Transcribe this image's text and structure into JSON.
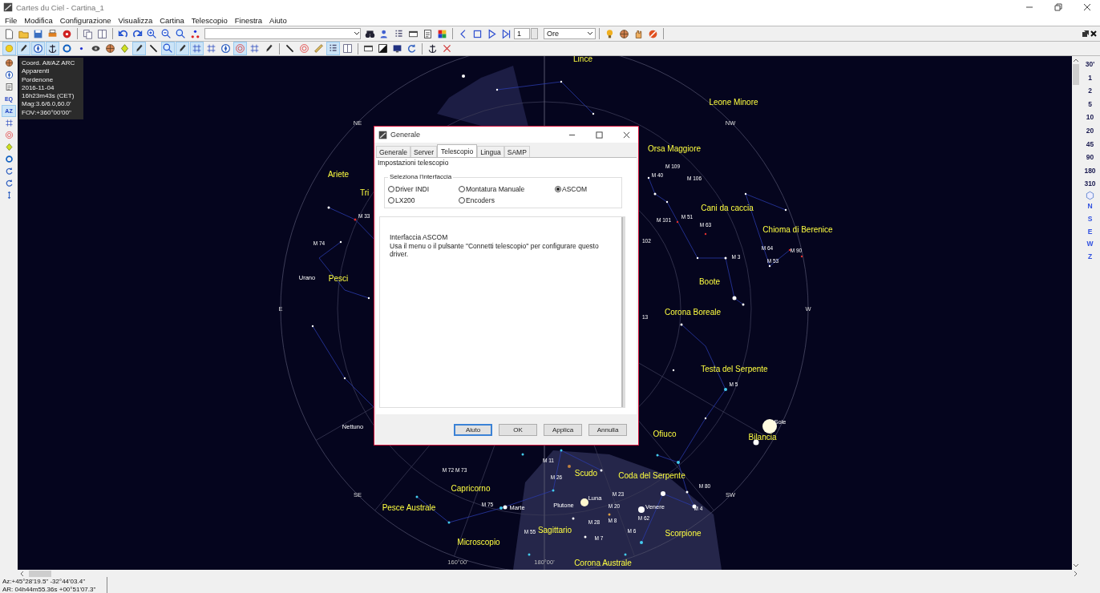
{
  "window": {
    "title": "Cartes du Ciel - Cartina_1"
  },
  "menu": [
    "File",
    "Modifica",
    "Configurazione",
    "Visualizza",
    "Cartina",
    "Telescopio",
    "Finestra",
    "Aiuto"
  ],
  "toolbar_1": {
    "frame_field": {
      "value": "1"
    },
    "step_select": {
      "value": "Ore"
    }
  },
  "toolbar_2": [
    {
      "pressed": true
    },
    {
      "pressed": true
    },
    {
      "pressed": true
    },
    {
      "pressed": true
    },
    {
      "pressed": false
    },
    {
      "pressed": false
    },
    {
      "pressed": false
    },
    {
      "pressed": false
    },
    {
      "pressed": false
    },
    {
      "pressed": true
    },
    {
      "pressed": false
    },
    {
      "pressed": true
    },
    {
      "pressed": true
    },
    {
      "pressed": true
    },
    {
      "pressed": false
    },
    {
      "pressed": false
    },
    {
      "pressed": true
    },
    {
      "pressed": false
    },
    {
      "pressed": false
    },
    {
      "pressed": false
    },
    {
      "pressed": false
    },
    {
      "pressed": false
    },
    {
      "pressed": true
    },
    {
      "pressed": false
    },
    {
      "pressed": false
    },
    {
      "pressed": false
    },
    {
      "pressed": false
    },
    {
      "pressed": false
    },
    {
      "pressed": false
    },
    {
      "pressed": false
    }
  ],
  "left_toolbar": [
    {
      "pressed": false
    },
    {
      "pressed": false
    },
    {
      "pressed": false
    },
    {
      "label": "EQ",
      "pressed": false
    },
    {
      "label": "AZ",
      "pressed": true
    },
    {
      "pressed": false
    },
    {
      "pressed": false
    },
    {
      "pressed": false
    },
    {
      "pressed": false
    },
    {
      "pressed": false
    },
    {
      "pressed": false
    },
    {
      "pressed": false
    }
  ],
  "info_panel": {
    "lines": [
      "Coord. Alt/AZ ARC",
      "Apparenti",
      "Pordenone",
      "2016-11-04",
      "16h23m43s (CET)",
      "Mag:3.6/6.0,60.0'",
      "FOV:+360°00'00\""
    ]
  },
  "sky_map": {
    "labels": [
      {
        "text": "Lince",
        "kind": "constellation"
      },
      {
        "text": "Leone Minore",
        "kind": "constellation"
      },
      {
        "text": "NE",
        "kind": "direction"
      },
      {
        "text": "NW",
        "kind": "direction"
      },
      {
        "text": "Orsa Maggiore",
        "kind": "constellation"
      },
      {
        "text": "M 109",
        "kind": "object"
      },
      {
        "text": "Ariete",
        "kind": "constellation"
      },
      {
        "text": "M 40",
        "kind": "object"
      },
      {
        "text": "M 106",
        "kind": "object"
      },
      {
        "text": "Tri",
        "kind": "constellation"
      },
      {
        "text": "Cani da caccia",
        "kind": "constellation"
      },
      {
        "text": "M 33",
        "kind": "object"
      },
      {
        "text": "M 51",
        "kind": "object"
      },
      {
        "text": "M 101",
        "kind": "object"
      },
      {
        "text": "M 63",
        "kind": "object"
      },
      {
        "text": "Chioma di Berenice",
        "kind": "constellation"
      },
      {
        "text": "102",
        "kind": "object"
      },
      {
        "text": "M 74",
        "kind": "object"
      },
      {
        "text": "M 64",
        "kind": "object"
      },
      {
        "text": "M 90",
        "kind": "object"
      },
      {
        "text": "M 3",
        "kind": "object"
      },
      {
        "text": "M 53",
        "kind": "object"
      },
      {
        "text": "Urano",
        "kind": "planet"
      },
      {
        "text": "Pesci",
        "kind": "constellation"
      },
      {
        "text": "Boote",
        "kind": "constellation"
      },
      {
        "text": "E",
        "kind": "direction"
      },
      {
        "text": "W",
        "kind": "direction"
      },
      {
        "text": "Corona Boreale",
        "kind": "constellation"
      },
      {
        "text": "13",
        "kind": "object"
      },
      {
        "text": "Testa del Serpente",
        "kind": "constellation"
      },
      {
        "text": "M 5",
        "kind": "object"
      },
      {
        "text": "Sole",
        "kind": "planet"
      },
      {
        "text": "Nettuno",
        "kind": "planet"
      },
      {
        "text": "Ofiuco",
        "kind": "constellation"
      },
      {
        "text": "Bilancia",
        "kind": "constellation"
      },
      {
        "text": "M 11",
        "kind": "object"
      },
      {
        "text": "M 72 M 73",
        "kind": "object"
      },
      {
        "text": "M 26",
        "kind": "object"
      },
      {
        "text": "Scudo",
        "kind": "constellation"
      },
      {
        "text": "Coda del Serpente",
        "kind": "constellation"
      },
      {
        "text": "M 80",
        "kind": "object"
      },
      {
        "text": "Capricorno",
        "kind": "constellation"
      },
      {
        "text": "SE",
        "kind": "direction"
      },
      {
        "text": "Luna",
        "kind": "planet"
      },
      {
        "text": "M 23",
        "kind": "object"
      },
      {
        "text": "SW",
        "kind": "direction"
      },
      {
        "text": "Pesce Australe",
        "kind": "constellation"
      },
      {
        "text": "M 75",
        "kind": "object"
      },
      {
        "text": "Marte",
        "kind": "planet"
      },
      {
        "text": "Plutone",
        "kind": "planet"
      },
      {
        "text": "M 20",
        "kind": "object"
      },
      {
        "text": "Venere",
        "kind": "planet"
      },
      {
        "text": "M 4",
        "kind": "object"
      },
      {
        "text": "M 28",
        "kind": "object"
      },
      {
        "text": "M 8",
        "kind": "object"
      },
      {
        "text": "M 62",
        "kind": "object"
      },
      {
        "text": "M 55",
        "kind": "object"
      },
      {
        "text": "Sagittario",
        "kind": "constellation"
      },
      {
        "text": "M 6",
        "kind": "object"
      },
      {
        "text": "Scorpione",
        "kind": "constellation"
      },
      {
        "text": "M 7",
        "kind": "object"
      },
      {
        "text": "Microscopio",
        "kind": "constellation"
      },
      {
        "text": "160°00'",
        "kind": "scale"
      },
      {
        "text": "180°00'",
        "kind": "scale"
      },
      {
        "text": "Corona Australe",
        "kind": "constellation"
      }
    ]
  },
  "zoom_panel": {
    "fields": [
      "30'",
      "1",
      "2",
      "5",
      "10",
      "20",
      "45",
      "90",
      "180",
      "310"
    ],
    "directions": [
      "N",
      "S",
      "E",
      "W",
      "Z"
    ]
  },
  "dialog": {
    "title": "Generale",
    "tabs": [
      {
        "label": "Generale",
        "selected": false
      },
      {
        "label": "Server",
        "selected": false
      },
      {
        "label": "Telescopio",
        "selected": true
      },
      {
        "label": "Lingua",
        "selected": false
      },
      {
        "label": "SAMP",
        "selected": false
      }
    ],
    "heading": "Impostazioni telescopio",
    "group": {
      "title": "Seleziona l'interfaccia",
      "options": [
        {
          "label": "Driver INDI",
          "selected": false
        },
        {
          "label": "Montatura Manuale",
          "selected": false
        },
        {
          "label": "ASCOM",
          "selected": true
        },
        {
          "label": "LX200",
          "selected": false
        },
        {
          "label": "Encoders",
          "selected": false
        }
      ]
    },
    "info_lines": [
      "Interfaccia ASCOM",
      "Usa il menu o il pulsante \"Connetti telescopio\" per configurare questo driver."
    ],
    "buttons": [
      {
        "label": "Aiuto",
        "focused": true
      },
      {
        "label": "OK",
        "focused": false
      },
      {
        "label": "Applica",
        "focused": false
      },
      {
        "label": "Annulla",
        "focused": false
      }
    ]
  },
  "status_bar": {
    "lines": [
      "Az:+45°28'19.5\" -32°44'03.4\"",
      "AR: 04h44m55.36s +00°51'07.3\""
    ]
  }
}
